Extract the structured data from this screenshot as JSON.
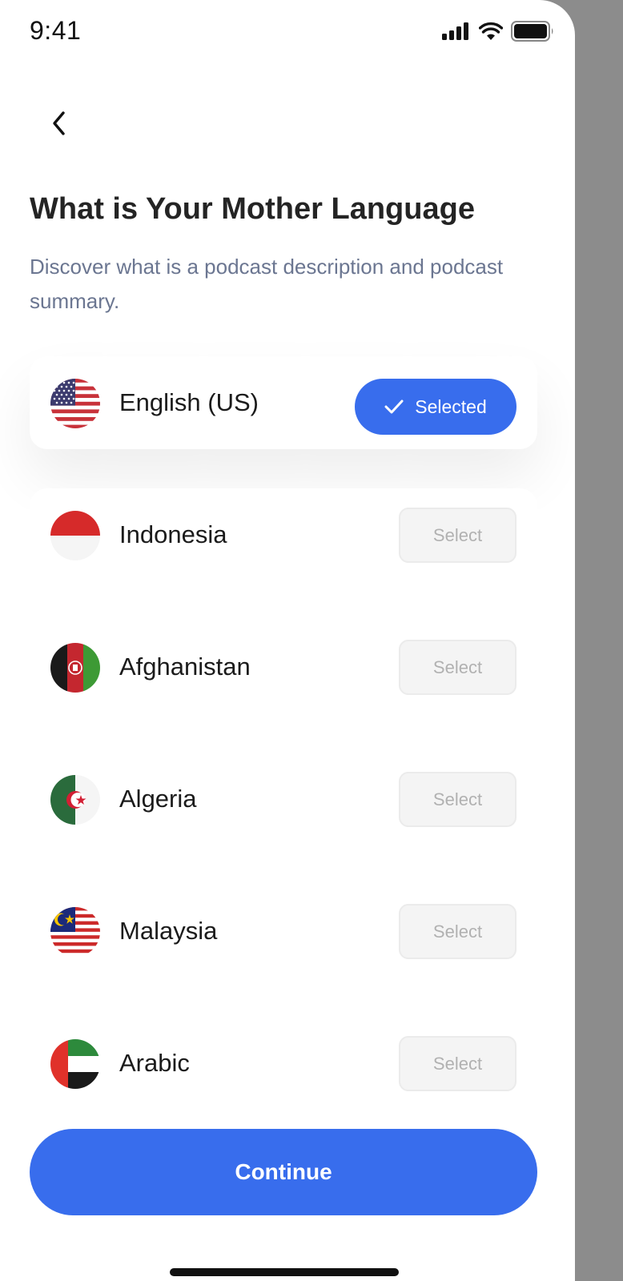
{
  "status_bar": {
    "time": "9:41"
  },
  "header": {
    "title": "What is Your Mother Language",
    "subtitle": "Discover what is a podcast description and podcast summary."
  },
  "languages": [
    {
      "name": "English (US)",
      "flag_icon": "us-flag-icon",
      "selected": true,
      "button_label": "Selected"
    },
    {
      "name": "Indonesia",
      "flag_icon": "indonesia-flag-icon",
      "selected": false,
      "button_label": "Select"
    },
    {
      "name": "Afghanistan",
      "flag_icon": "afghanistan-flag-icon",
      "selected": false,
      "button_label": "Select"
    },
    {
      "name": "Algeria",
      "flag_icon": "algeria-flag-icon",
      "selected": false,
      "button_label": "Select"
    },
    {
      "name": "Malaysia",
      "flag_icon": "malaysia-flag-icon",
      "selected": false,
      "button_label": "Select"
    },
    {
      "name": "Arabic",
      "flag_icon": "uae-flag-icon",
      "selected": false,
      "button_label": "Select"
    }
  ],
  "continue_button": {
    "label": "Continue"
  },
  "colors": {
    "accent": "#386ded",
    "title": "#242424",
    "subtitle": "#6b7691",
    "unselected_button_bg": "#f4f4f4",
    "unselected_button_text": "#b1b1b1",
    "backdrop": "#8c8c8c"
  }
}
